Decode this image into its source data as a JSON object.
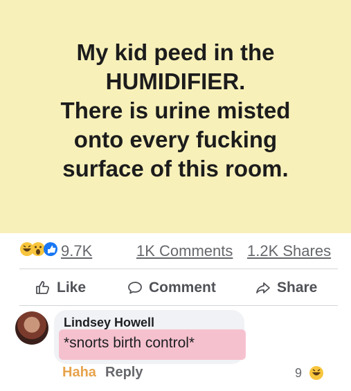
{
  "post": {
    "text_lines": [
      "My kid peed in the",
      "HUMIDIFIER.",
      "There is urine misted",
      "onto every fucking",
      "surface of this room."
    ],
    "background_color": "#f7f0b9"
  },
  "stats": {
    "reaction_icons": [
      "haha-icon",
      "wow-icon",
      "like-icon"
    ],
    "reactions": "9.7K",
    "comments": "1K Comments",
    "shares": "1.2K Shares"
  },
  "actions": {
    "like": "Like",
    "comment": "Comment",
    "share": "Share"
  },
  "comment": {
    "author": "Lindsey Howell",
    "text": "*snorts birth control*",
    "highlight_color": "#f7b9c8",
    "reaction_label": "Haha",
    "reply_label": "Reply",
    "reaction_count": "9",
    "reaction_icon": "haha-icon"
  }
}
